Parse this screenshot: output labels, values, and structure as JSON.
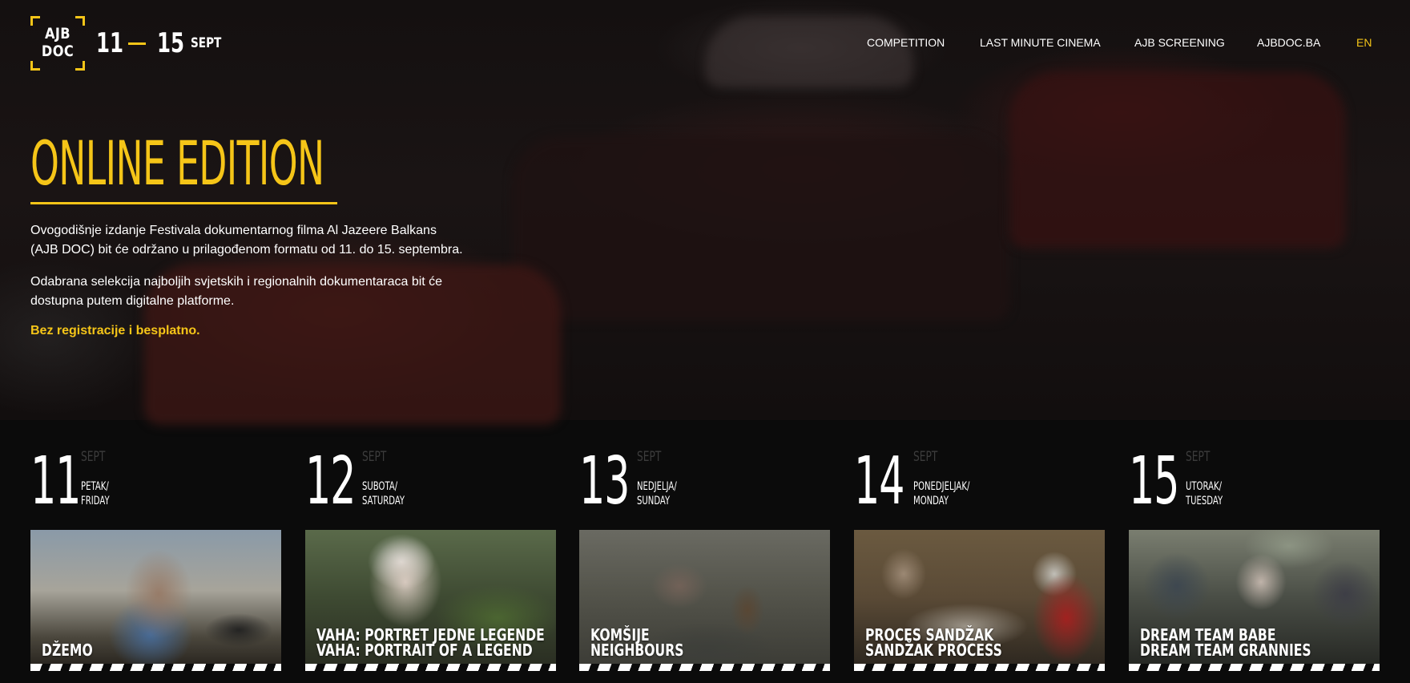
{
  "header": {
    "logo": "AJB DOC",
    "logo_line1": "AJB",
    "logo_line2": "DOC",
    "date_start": "11",
    "date_end": "15",
    "date_month": "SEPT",
    "accent": "#f5c518"
  },
  "nav": {
    "items": [
      {
        "label": "COMPETITION"
      },
      {
        "label": "LAST MINUTE CINEMA"
      },
      {
        "label": "AJB SCREENING"
      },
      {
        "label": "AJBDOC.BA"
      }
    ],
    "lang": "EN"
  },
  "hero": {
    "title": "ONLINE EDITION",
    "p1_line1": "Ovogodišnje izdanje Festivala dokumentarnog filma Al Jazeere Balkans",
    "p1_line2": "(AJB DOC) bit će održano u prilagođenom formatu od 11. do 15. septembra.",
    "p2_line1": "Odabrana selekcija najboljih svjetskih i regionalnih dokumentaraca bit će",
    "p2_line2": "dostupna putem digitalne platforme.",
    "cta": "Bez registracije i besplatno."
  },
  "days": [
    {
      "num": "11",
      "month": "SEPT",
      "local": "PETAK/",
      "en": "FRIDAY",
      "film_line1": "DŽEMO",
      "film_line2": ""
    },
    {
      "num": "12",
      "month": "SEPT",
      "local": "SUBOTA/",
      "en": "SATURDAY",
      "film_line1": "VAHA: PORTRET JEDNE LEGENDE",
      "film_line2": "VAHA: PORTRAIT OF A LEGEND"
    },
    {
      "num": "13",
      "month": "SEPT",
      "local": "NEDJELJA/",
      "en": "SUNDAY",
      "film_line1": "KOMŠIJE",
      "film_line2": "NEIGHBOURS"
    },
    {
      "num": "14",
      "month": "SEPT",
      "local": "PONEDJELJAK/",
      "en": "MONDAY",
      "film_line1": "PROCES SANDŽAK",
      "film_line2": "SANDŽAK PROCESS"
    },
    {
      "num": "15",
      "month": "SEPT",
      "local": "UTORAK/",
      "en": "TUESDAY",
      "film_line1": "DREAM TEAM BABE",
      "film_line2": "DREAM TEAM GRANNIES"
    }
  ]
}
